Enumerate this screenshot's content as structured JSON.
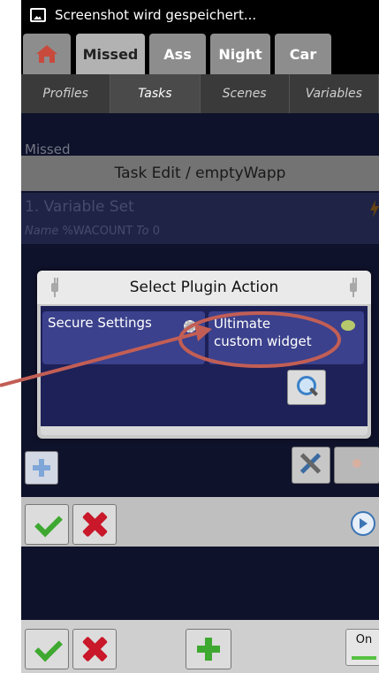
{
  "status_bar": {
    "text": "Screenshot wird gespeichert...",
    "icon": "image-icon"
  },
  "tabs": [
    {
      "label": "",
      "icon": "home-icon"
    },
    {
      "label": "Missed",
      "active": true
    },
    {
      "label": "Ass"
    },
    {
      "label": "Night"
    },
    {
      "label": "Car"
    }
  ],
  "subtabs": [
    "Profiles",
    "Tasks",
    "Scenes",
    "Variables"
  ],
  "section_label": "Missed",
  "task_header": "Task Edit / emptyWapp",
  "action": {
    "title": "1.  Variable Set",
    "subtitle_name_label": "Name",
    "subtitle_value": "%WACOUNT",
    "subtitle_to_label": "To",
    "subtitle_to_value": "0"
  },
  "dialog": {
    "title": "Select Plugin Action",
    "plugins": [
      {
        "label": "Secure Settings",
        "icon": "gear-icon"
      },
      {
        "label": "Ultimate custom widget",
        "line1": "Ultimate",
        "line2": "custom widget",
        "icon": "widget-icon"
      }
    ],
    "search_icon": "search-icon"
  },
  "colors": {
    "background": "#14183a",
    "accent_blue": "#3b418c",
    "check_green": "#3ea830",
    "cross_red": "#c8182a",
    "annotation": "#c25e55"
  },
  "bottom_bar": {
    "toggle_label": "On"
  }
}
